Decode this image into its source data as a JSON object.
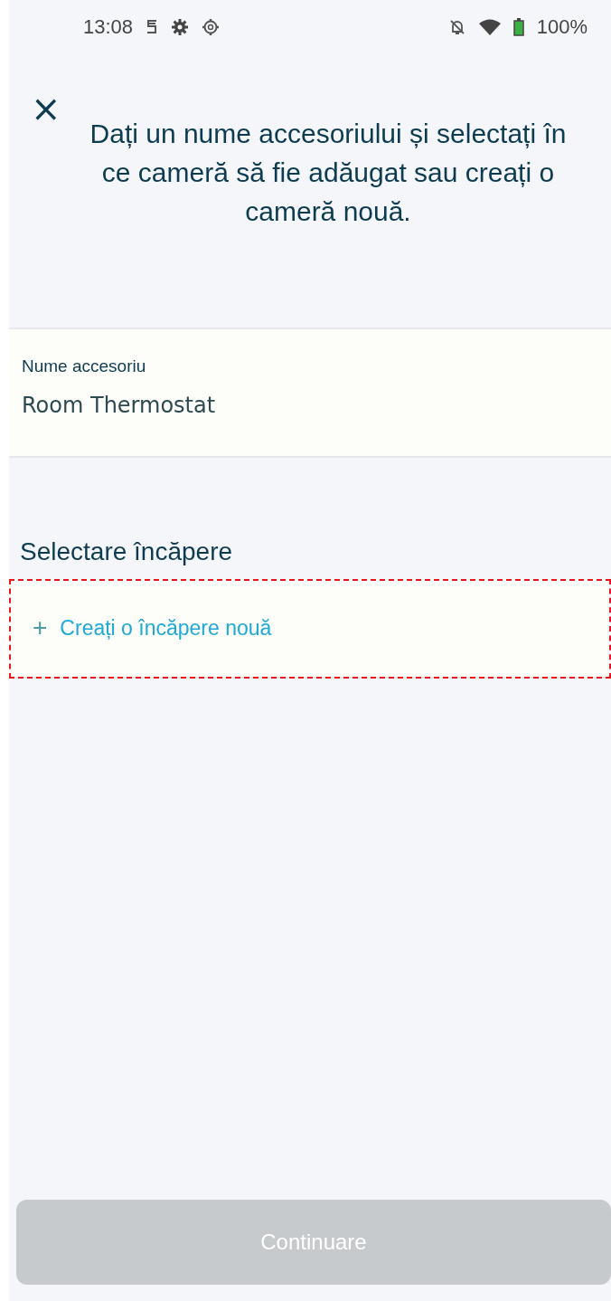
{
  "status_bar": {
    "time": "13:08",
    "battery": "100%"
  },
  "header": {
    "close": "×",
    "title": "Dați un nume accesoriului și selectați în ce cameră să fie adăugat sau creați o cameră nouă."
  },
  "name_field": {
    "label": "Nume accesoriu",
    "value": "Room Thermostat"
  },
  "room_section": {
    "heading": "Selectare încăpere",
    "create_row": {
      "icon": "+",
      "label": "Creați o încăpere nouă",
      "highlighted": true
    }
  },
  "continue_button": {
    "label": "Continuare",
    "disabled": true
  }
}
